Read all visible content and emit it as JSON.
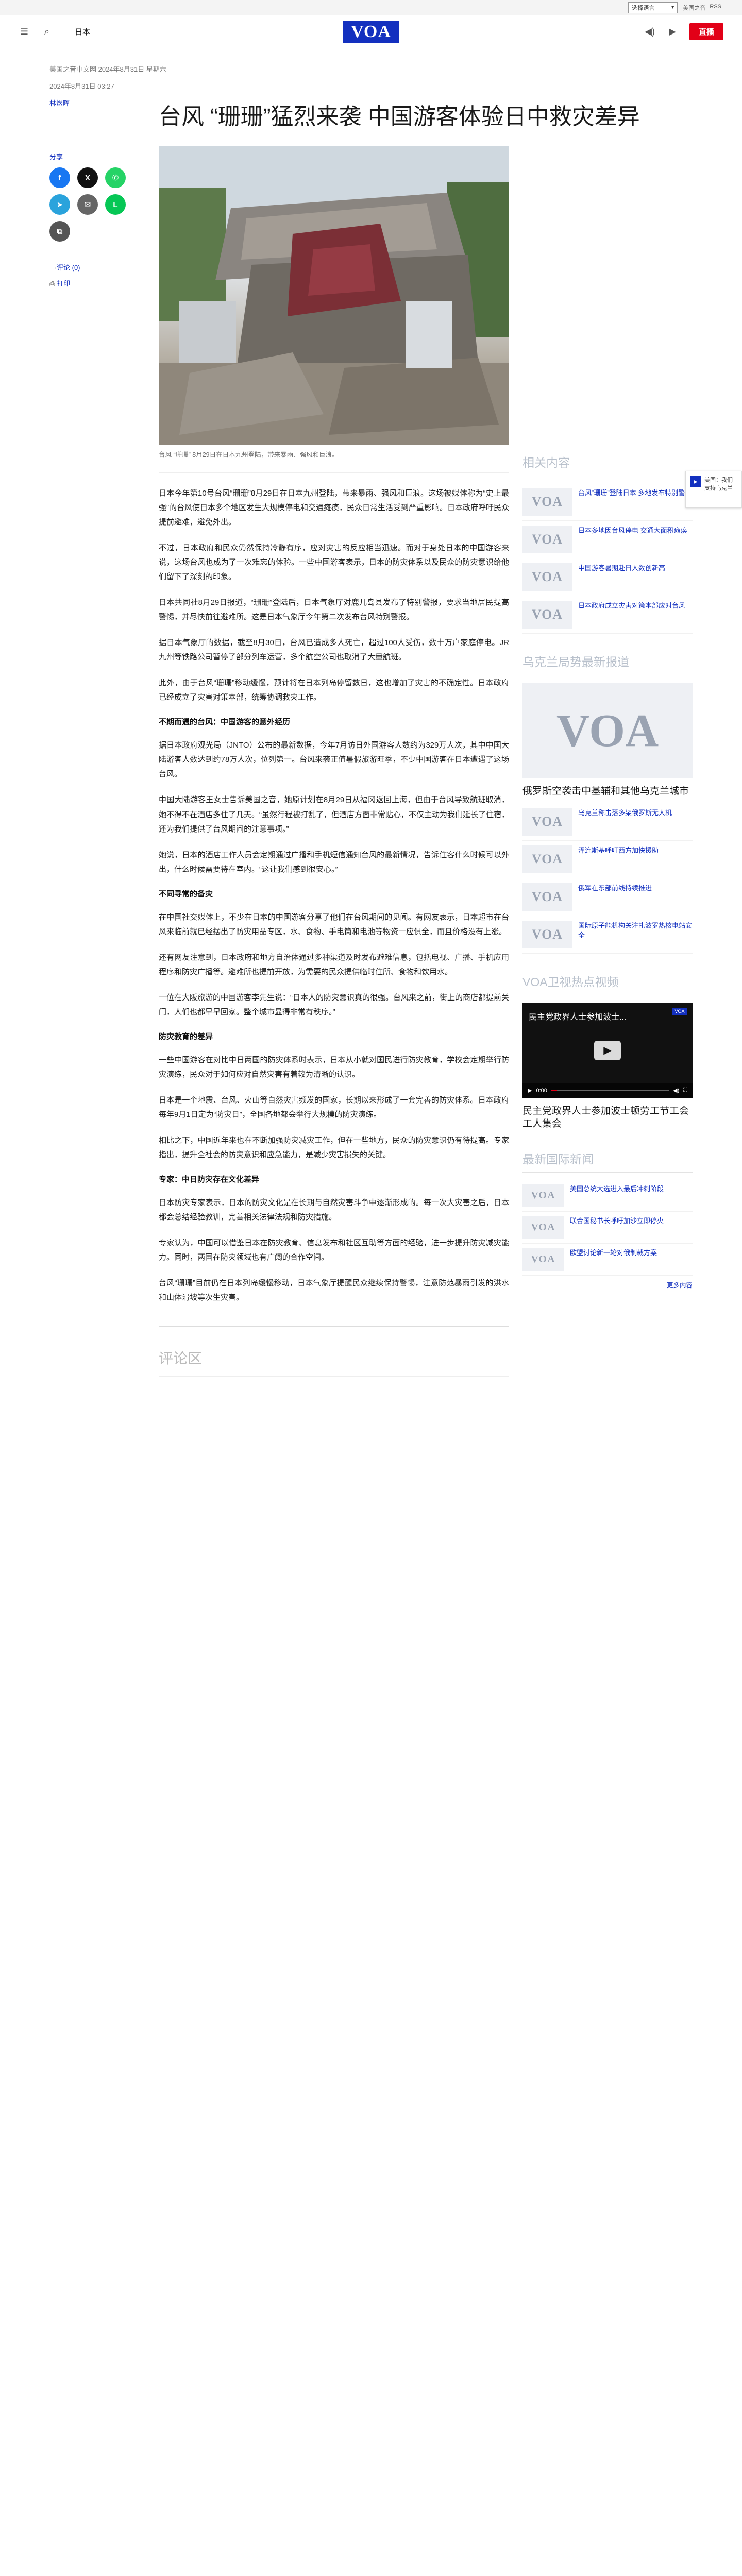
{
  "utilbar": {
    "language_select": "选择语言",
    "links": [
      "美国之音",
      "RSS"
    ]
  },
  "header": {
    "section": "日本",
    "live_label": "直播",
    "logo": "VOA"
  },
  "article": {
    "meta_line": "美国之音中文网 2024年8月31日 星期六",
    "updated": "2024年8月31日 03:27",
    "byline": "林煜晖",
    "title": "台风 “珊珊”猛烈来袭 中国游客体验日中救灾差异",
    "caption": "台风 “珊珊” 8月29日在日本九州登陆，带来暴雨、强风和巨浪。",
    "paragraphs_a": [
      "日本今年第10号台风“珊珊”8月29日在日本九州登陆，带来暴雨、强风和巨浪。这场被媒体称为“史上最强”的台风使日本多个地区发生大规模停电和交通瘫痪，民众日常生活受到严重影响。日本政府呼吁民众提前避难，避免外出。",
      "不过，日本政府和民众仍然保持冷静有序，应对灾害的反应相当迅速。而对于身处日本的中国游客来说，这场台风也成为了一次难忘的体验。一些中国游客表示，日本的防灾体系以及民众的防灾意识给他们留下了深刻的印象。",
      "日本共同社8月29日报道，“珊珊”登陆后，日本气象厅对鹿儿岛县发布了特别警报，要求当地居民提高警惕，并尽快前往避难所。这是日本气象厅今年第二次发布台风特别警报。",
      "据日本气象厅的数据，截至8月30日，台风已造成多人死亡，超过100人受伤，数十万户家庭停电。JR九州等铁路公司暂停了部分列车运营，多个航空公司也取消了大量航班。",
      "此外，由于台风“珊珊”移动缓慢，预计将在日本列岛停留数日，这也增加了灾害的不确定性。日本政府已经成立了灾害对策本部，统筹协调救灾工作。"
    ],
    "heading_1": "不期而遇的台风：中国游客的意外经历",
    "paragraphs_b": [
      "据日本政府观光局（JNTO）公布的最新数据，今年7月访日外国游客人数约为329万人次，其中中国大陆游客人数达到约78万人次，位列第一。台风来袭正值暑假旅游旺季，不少中国游客在日本遭遇了这场台风。",
      "中国大陆游客王女士告诉美国之音，她原计划在8月29日从福冈返回上海，但由于台风导致航班取消，她不得不在酒店多住了几天。“虽然行程被打乱了，但酒店方面非常贴心，不仅主动为我们延长了住宿，还为我们提供了台风期间的注意事项。”",
      "她说，日本的酒店工作人员会定期通过广播和手机短信通知台风的最新情况，告诉住客什么时候可以外出，什么时候需要待在室内。“这让我们感到很安心。”"
    ],
    "heading_2": "不同寻常的备灾",
    "paragraphs_c": [
      "在中国社交媒体上，不少在日本的中国游客分享了他们在台风期间的见闻。有网友表示，日本超市在台风来临前就已经摆出了防灾用品专区，水、食物、手电筒和电池等物资一应俱全，而且价格没有上涨。",
      "还有网友注意到，日本政府和地方自治体通过多种渠道及时发布避难信息，包括电视、广播、手机应用程序和防灾广播等。避难所也提前开放，为需要的民众提供临时住所、食物和饮用水。",
      "一位在大阪旅游的中国游客李先生说：“日本人的防灾意识真的很强。台风来之前，街上的商店都提前关门，人们也都早早回家。整个城市显得非常有秩序。”"
    ],
    "heading_3": "防灾教育的差异",
    "paragraphs_d": [
      "一些中国游客在对比中日两国的防灾体系时表示，日本从小就对国民进行防灾教育，学校会定期举行防灾演练，民众对于如何应对自然灾害有着较为清晰的认识。",
      "日本是一个地震、台风、火山等自然灾害频发的国家，长期以来形成了一套完善的防灾体系。日本政府每年9月1日定为“防灾日”，全国各地都会举行大规模的防灾演练。",
      "相比之下，中国近年来也在不断加强防灾减灾工作，但在一些地方，民众的防灾意识仍有待提高。专家指出，提升全社会的防灾意识和应急能力，是减少灾害损失的关键。"
    ],
    "heading_4": "专家：中日防灾存在文化差异",
    "paragraphs_e": [
      "日本防灾专家表示，日本的防灾文化是在长期与自然灾害斗争中逐渐形成的。每一次大灾害之后，日本都会总结经验教训，完善相关法律法规和防灾措施。",
      "专家认为，中国可以借鉴日本在防灾教育、信息发布和社区互助等方面的经验，进一步提升防灾减灾能力。同时，两国在防灾领域也有广阔的合作空间。",
      "台风“珊珊”目前仍在日本列岛缓慢移动，日本气象厅提醒民众继续保持警惕，注意防范暴雨引发的洪水和山体滑坡等次生灾害。"
    ],
    "comments_heading": "评论区",
    "share_label": "分享",
    "links": [
      "评论 (0)",
      "打印"
    ]
  },
  "sidebar": {
    "related_heading": "相关内容",
    "related": [
      "台风“珊珊”登陆日本 多地发布特别警报",
      "日本多地因台风停电 交通大面积瘫痪",
      "中国游客暑期赴日人数创新高",
      "日本政府成立灾害对策本部应对台风"
    ],
    "featured_heading": "乌克兰局势最新报道",
    "featured_title": "俄罗斯空袭击中基辅和其他乌克兰城市",
    "featured_list": [
      "乌克兰称击落多架俄罗斯无人机",
      "泽连斯基呼吁西方加快援助",
      "俄军在东部前线持续推进",
      "国际原子能机构关注扎波罗热核电站安全"
    ],
    "video_heading": "VOA卫视热点视频",
    "video_title_overlay": "民主党政界人士参加波士...",
    "video_time": "0:00",
    "video_progress": 0.05,
    "video_caption": "民主党政界人士参加波士顿劳工节工会工人集会",
    "news_heading": "最新国际新闻",
    "news": [
      "美国总统大选进入最后冲刺阶段",
      "联合国秘书长呼吁加沙立即停火",
      "欧盟讨论新一轮对俄制裁方案"
    ],
    "more_label": "更多内容",
    "floating_text": "美国：我们支持乌克兰"
  }
}
